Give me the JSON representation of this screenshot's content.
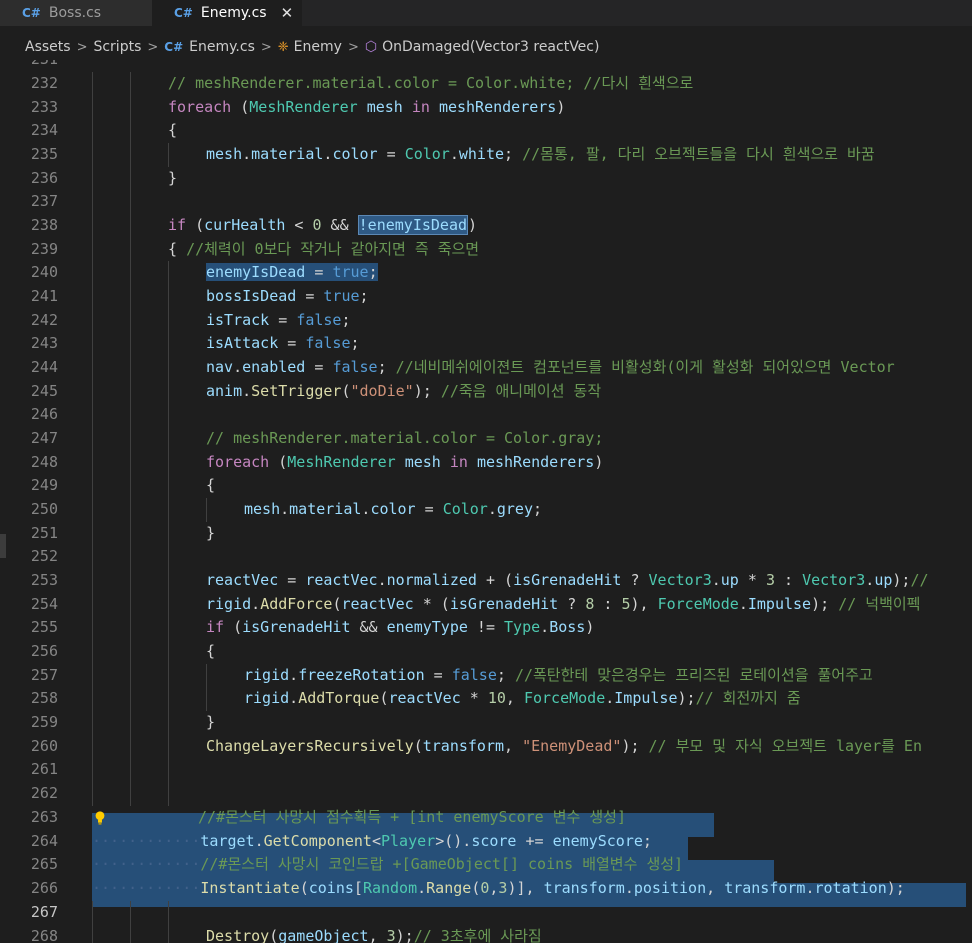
{
  "tabs": [
    {
      "label": "Boss.cs",
      "active": false,
      "icon": "csharp-file-icon"
    },
    {
      "label": "Enemy.cs",
      "active": true,
      "icon": "csharp-file-icon",
      "close_glyph": "✕"
    }
  ],
  "breadcrumb": {
    "items": [
      "Assets",
      "Scripts",
      "Enemy.cs",
      "Enemy",
      "OnDamaged(Vector3 reactVec)"
    ],
    "separator": ">",
    "icons": [
      "csharp-file-icon",
      "class-icon",
      "method-icon"
    ]
  },
  "editor": {
    "line_numbers": [
      "231",
      "232",
      "233",
      "234",
      "235",
      "236",
      "237",
      "238",
      "239",
      "240",
      "241",
      "242",
      "243",
      "244",
      "245",
      "246",
      "247",
      "248",
      "249",
      "250",
      "251",
      "252",
      "253",
      "254",
      "255",
      "256",
      "257",
      "258",
      "259",
      "260",
      "261",
      "262",
      "263",
      "264",
      "265",
      "266",
      "267",
      "268"
    ],
    "current_line": "267",
    "lines": {
      "231": "",
      "232": "// meshRenderer.material.color = Color.white; //다시 흰색으로",
      "233_kw": "foreach",
      "233_type": "MeshRenderer",
      "233_var": "mesh",
      "233_in": "in",
      "233_coll": "meshRenderers",
      "235_a": "mesh",
      "235_b": "material",
      "235_c": "color",
      "235_d": "Color",
      "235_e": "white",
      "235_cm": "//몸통, 팔, 다리 오브젝트들을 다시 흰색으로 바꿈",
      "238_if": "if",
      "238_v1": "curHealth",
      "238_n": "0",
      "238_sel": "!enemyIsDead",
      "239_cm": "//체력이 0보다 작거나 같아지면 즉 죽으면",
      "240_v": "enemyIsDead",
      "240_t": "true",
      "241_v": "bossIsDead",
      "241_t": "true",
      "242_v": "isTrack",
      "242_f": "false",
      "243_v": "isAttack",
      "243_f": "false",
      "244_v": "nav",
      "244_p": "enabled",
      "244_f": "false",
      "244_cm": "//네비메쉬에이젼트 컴포넌트를 비활성화(이게 활성화 되어있으면 Vector",
      "245_v": "anim",
      "245_fn": "SetTrigger",
      "245_s": "\"doDie\"",
      "245_cm": "//죽음 애니메이션 동작",
      "247": "// meshRenderer.material.color = Color.gray;",
      "250_a": "mesh",
      "250_b": "material",
      "250_c": "color",
      "250_d": "Color",
      "250_e": "grey",
      "253_v": "reactVec",
      "253_n": "normalized",
      "253_g": "isGrenadeHit",
      "253_vec": "Vector3",
      "253_up": "up",
      "253_3": "3",
      "253_cm": "//",
      "254_r": "rigid",
      "254_fn": "AddForce",
      "254_v": "reactVec",
      "254_g": "isGrenadeHit",
      "254_8": "8",
      "254_5": "5",
      "254_fm": "ForceMode",
      "254_imp": "Impulse",
      "254_cm": "// 넉백이펙",
      "255_if": "if",
      "255_g": "isGrenadeHit",
      "255_et": "enemyType",
      "255_t": "Type",
      "255_b": "Boss",
      "257_r": "rigid",
      "257_p": "freezeRotation",
      "257_f": "false",
      "257_cm": "//폭탄한테 맞은경우는 프리즈된 로테이션을 풀어주고",
      "258_r": "rigid",
      "258_fn": "AddTorque",
      "258_v": "reactVec",
      "258_10": "10",
      "258_fm": "ForceMode",
      "258_imp": "Impulse",
      "258_cm": "// 회전까지 줌",
      "260_fn": "ChangeLayersRecursively",
      "260_v": "transform",
      "260_s": "\"EnemyDead\"",
      "260_cm": "// 부모 및 자식 오브젝트 layer를 En",
      "263_cm": "//#몬스터 사망시 점수획득 + [int enemyScore 변수 생성]",
      "264_v": "target",
      "264_fn": "GetComponent",
      "264_ty": "Player",
      "264_p": "score",
      "264_e": "enemyScore",
      "265_cm": "//#몬스터 사망시 코인드랍 +[GameObject[] coins 배열변수 생성]",
      "266_fn": "Instantiate",
      "266_c": "coins",
      "266_ty": "Random",
      "266_fn2": "Range",
      "266_0": "0",
      "266_3": "3",
      "266_t": "transform",
      "266_pos": "position",
      "266_rot": "rotation",
      "268_fn": "Destroy",
      "268_go": "gameObject",
      "268_3": "3",
      "268_cm": "// 3초후에 사라짐"
    }
  },
  "colors": {
    "background": "#1e1e1e",
    "selection": "#264f78",
    "keyword": "#569cd6",
    "control": "#c586c0",
    "type": "#4ec9b0",
    "variable": "#9cdcfe",
    "function": "#dcdcaa",
    "string": "#ce9178",
    "number": "#b5cea8",
    "comment": "#6a9955"
  }
}
